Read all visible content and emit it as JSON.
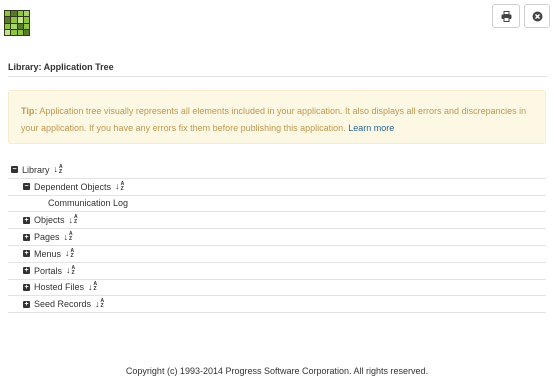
{
  "header": {
    "print_icon": "printer-icon",
    "close_icon": "close-circle-icon"
  },
  "page": {
    "title": "Library: Application Tree"
  },
  "tip": {
    "label": "Tip:",
    "text": " Application tree visually represents all elements included in your application. It also displays all errors and discrepancies in your application. If you have any errors fix them before publishing this application. ",
    "link": "Learn more"
  },
  "tree": {
    "root": {
      "label": "Library",
      "state": "expanded"
    },
    "items": [
      {
        "label": "Dependent Objects",
        "state": "expanded",
        "level": 1,
        "sortable": true
      },
      {
        "label": "Communication Log",
        "state": "leaf",
        "level": 2,
        "sortable": false
      },
      {
        "label": "Objects",
        "state": "collapsed",
        "level": 1,
        "sortable": true
      },
      {
        "label": "Pages",
        "state": "collapsed",
        "level": 1,
        "sortable": true
      },
      {
        "label": "Menus",
        "state": "collapsed",
        "level": 1,
        "sortable": true
      },
      {
        "label": "Portals",
        "state": "collapsed",
        "level": 1,
        "sortable": true
      },
      {
        "label": "Hosted Files",
        "state": "collapsed",
        "level": 1,
        "sortable": true
      },
      {
        "label": "Seed Records",
        "state": "collapsed",
        "level": 1,
        "sortable": true
      }
    ]
  },
  "footer": {
    "copyright": "Copyright (c) 1993-2014 Progress Software Corporation. All rights reserved."
  },
  "colors": {
    "tip_bg": "#fcf8e3",
    "tip_text": "#c09853",
    "link": "#2a6496",
    "logo_dark": "#2f3a1c",
    "logo_green": "#8cc63f"
  }
}
